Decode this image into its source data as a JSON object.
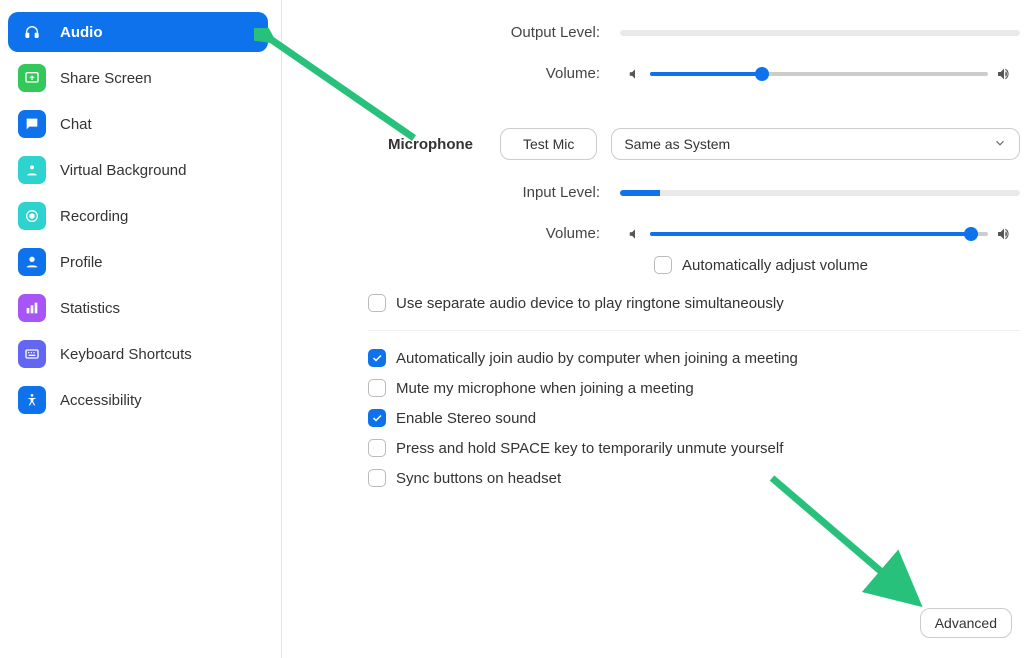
{
  "sidebar": {
    "items": [
      {
        "label": "Audio",
        "icon": "headphones-icon",
        "color": "transparent",
        "active": true
      },
      {
        "label": "Share Screen",
        "icon": "share-screen-icon",
        "color": "#34c759"
      },
      {
        "label": "Chat",
        "icon": "chat-icon",
        "color": "#0e72ed"
      },
      {
        "label": "Virtual Background",
        "icon": "virtual-bg-icon",
        "color": "#2dd4cf"
      },
      {
        "label": "Recording",
        "icon": "recording-icon",
        "color": "#2dd4cf"
      },
      {
        "label": "Profile",
        "icon": "profile-icon",
        "color": "#0e72ed"
      },
      {
        "label": "Statistics",
        "icon": "statistics-icon",
        "color": "#a855f7"
      },
      {
        "label": "Keyboard Shortcuts",
        "icon": "keyboard-icon",
        "color": "#6366f1"
      },
      {
        "label": "Accessibility",
        "icon": "accessibility-icon",
        "color": "#0e72ed"
      }
    ]
  },
  "audio": {
    "output_level_label": "Output Level:",
    "output_volume_label": "Volume:",
    "output_volume_pct": 33,
    "microphone_label": "Microphone",
    "test_mic_label": "Test Mic",
    "mic_device": "Same as System",
    "input_level_label": "Input Level:",
    "input_level_pct": 10,
    "input_volume_label": "Volume:",
    "input_volume_pct": 95,
    "auto_adjust_label": "Automatically adjust volume",
    "auto_adjust_checked": false,
    "ringtone_label": "Use separate audio device to play ringtone simultaneously",
    "ringtone_checked": false,
    "options": [
      {
        "label": "Automatically join audio by computer when joining a meeting",
        "checked": true
      },
      {
        "label": "Mute my microphone when joining a meeting",
        "checked": false
      },
      {
        "label": "Enable Stereo sound",
        "checked": true
      },
      {
        "label": "Press and hold SPACE key to temporarily unmute yourself",
        "checked": false
      },
      {
        "label": "Sync buttons on headset",
        "checked": false
      }
    ],
    "advanced_label": "Advanced"
  },
  "colors": {
    "accent": "#0e72ed",
    "arrow": "#28c17b"
  }
}
